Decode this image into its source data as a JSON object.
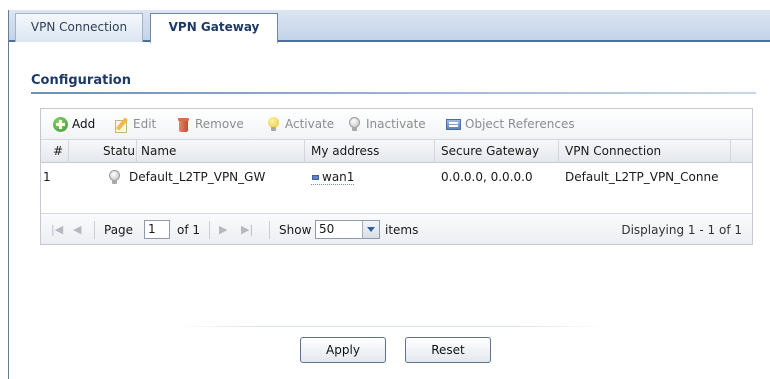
{
  "tabs": [
    {
      "label": "VPN Connection",
      "active": false
    },
    {
      "label": "VPN Gateway",
      "active": true
    }
  ],
  "section": {
    "title": "Configuration"
  },
  "toolbar": {
    "add": "Add",
    "edit": "Edit",
    "remove": "Remove",
    "activate": "Activate",
    "inactivate": "Inactivate",
    "object_references": "Object References"
  },
  "table": {
    "columns": [
      "#",
      "Statu:",
      "Name",
      "My address",
      "Secure Gateway",
      "VPN Connection"
    ],
    "rows": [
      {
        "num": "1",
        "status_icon": "lightbulb-off-icon",
        "name": "Default_L2TP_VPN_GW",
        "my_address": "wan1",
        "secure_gateway": "0.0.0.0, 0.0.0.0",
        "vpn_connection": "Default_L2TP_VPN_Conne"
      }
    ]
  },
  "pager": {
    "page_label": "Page",
    "page_value": "1",
    "of_label": "of 1",
    "show_label": "Show",
    "show_value": "50",
    "items_label": "items",
    "display_text": "Displaying 1 - 1 of 1"
  },
  "buttons": {
    "apply": "Apply",
    "reset": "Reset"
  },
  "colors": {
    "tab_bar": "#c3d3e8",
    "tab_border": "#4d6f9f",
    "title_text": "#1d3a66",
    "add_icon": "#3a9a2a",
    "remove_icon": "#c84a2a",
    "activate_icon": "#e8c430"
  }
}
